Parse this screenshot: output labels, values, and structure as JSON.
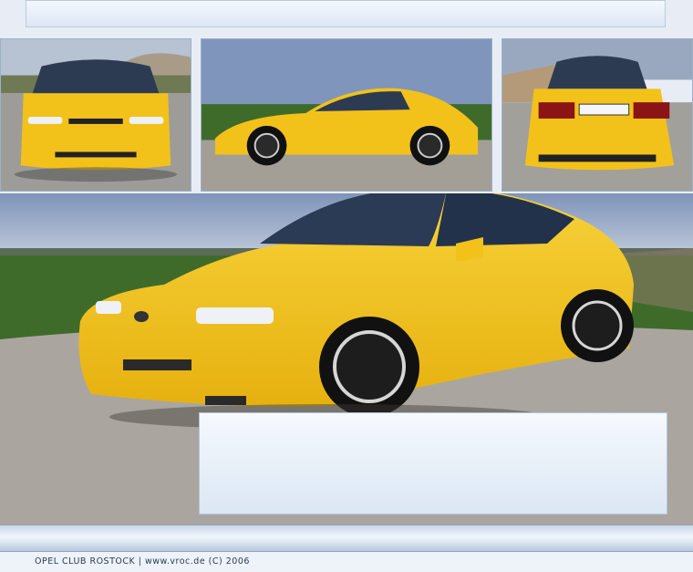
{
  "footer": {
    "text": "OPEL CLUB ROSTOCK  |  www.vroc.de  (C) 2006"
  },
  "photos": {
    "front": "yellow-car-front-photo",
    "side": "yellow-car-side-photo",
    "rear": "yellow-car-rear-photo",
    "main": "yellow-car-three-quarter-photo"
  },
  "colors": {
    "car_yellow": "#f2c21b",
    "page_bg": "#e8edf5",
    "sky": "#8fa3c4",
    "road": "#a8a49c",
    "grass": "#3f6b2a"
  }
}
